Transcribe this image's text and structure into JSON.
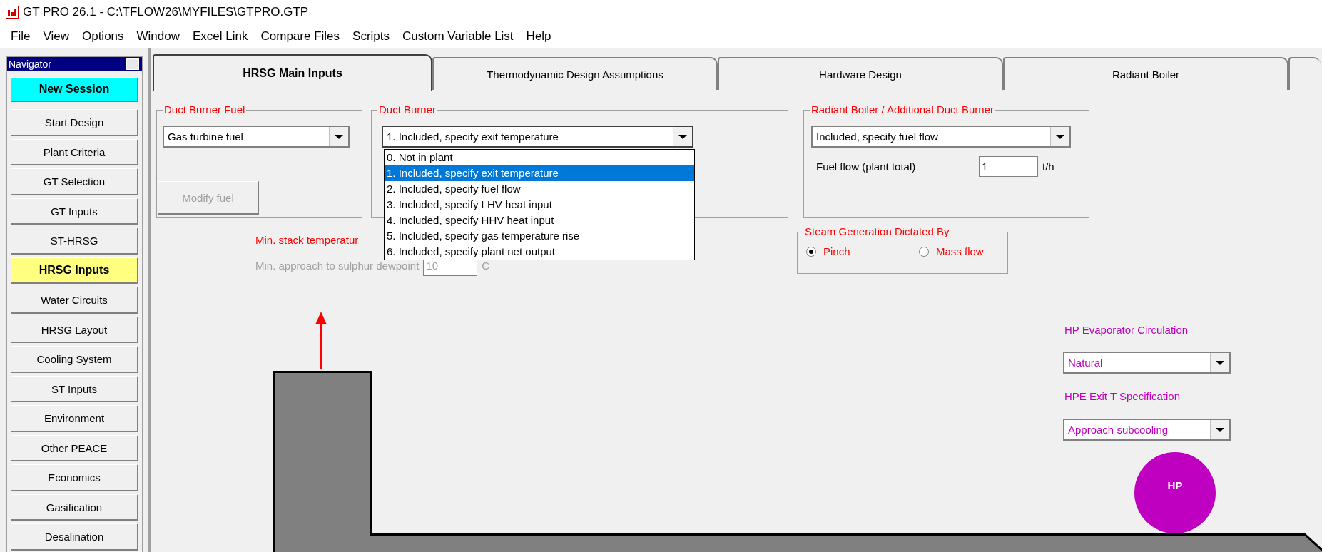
{
  "window": {
    "title": "GT PRO 26.1 - C:\\TFLOW26\\MYFILES\\GTPRO.GTP"
  },
  "menu": [
    "File",
    "View",
    "Options",
    "Window",
    "Excel Link",
    "Compare Files",
    "Scripts",
    "Custom Variable List",
    "Help"
  ],
  "navigator": {
    "title": "Navigator",
    "items": [
      {
        "label": "New Session",
        "kind": "action",
        "selected": false
      },
      {
        "label": "Start Design",
        "kind": "step",
        "selected": false
      },
      {
        "label": "Plant Criteria",
        "kind": "step",
        "selected": false
      },
      {
        "label": "GT Selection",
        "kind": "step",
        "selected": false
      },
      {
        "label": "GT Inputs",
        "kind": "step",
        "selected": false
      },
      {
        "label": "ST-HRSG",
        "kind": "step",
        "selected": false
      },
      {
        "label": "HRSG Inputs",
        "kind": "step",
        "selected": true
      },
      {
        "label": "Water Circuits",
        "kind": "step",
        "selected": false
      },
      {
        "label": "HRSG Layout",
        "kind": "step",
        "selected": false
      },
      {
        "label": "Cooling System",
        "kind": "step",
        "selected": false
      },
      {
        "label": "ST Inputs",
        "kind": "step",
        "selected": false
      },
      {
        "label": "Environment",
        "kind": "step",
        "selected": false
      },
      {
        "label": "Other PEACE",
        "kind": "step",
        "selected": false
      },
      {
        "label": "Economics",
        "kind": "step",
        "selected": false
      },
      {
        "label": "Gasification",
        "kind": "step",
        "selected": false
      },
      {
        "label": "Desalination",
        "kind": "step",
        "selected": false
      }
    ]
  },
  "tabs": [
    {
      "label": "HRSG Main Inputs",
      "selected": true
    },
    {
      "label": "Thermodynamic Design Assumptions",
      "selected": false
    },
    {
      "label": "Hardware Design",
      "selected": false
    },
    {
      "label": "Radiant Boiler",
      "selected": false
    }
  ],
  "duct_burner_fuel": {
    "title": "Duct Burner Fuel",
    "value": "Gas turbine fuel",
    "button": {
      "label": "Modify fuel",
      "disabled": true
    }
  },
  "duct_burner": {
    "title": "Duct Burner",
    "value": "1. Included, specify exit temperature",
    "expanded": true,
    "options": [
      {
        "label": "0. Not in plant",
        "selected": false
      },
      {
        "label": "1. Included, specify exit temperature",
        "selected": true
      },
      {
        "label": "2. Included, specify fuel flow",
        "selected": false
      },
      {
        "label": "3. Included, specify LHV heat input",
        "selected": false
      },
      {
        "label": "4. Included, specify HHV heat input",
        "selected": false
      },
      {
        "label": "5. Included, specify gas temperature rise",
        "selected": false
      },
      {
        "label": "6. Included, specify plant net output",
        "selected": false
      }
    ]
  },
  "radiant_boiler": {
    "title": "Radiant Boiler / Additional Duct Burner",
    "value": "Included, specify fuel flow",
    "fuel_flow": {
      "label": "Fuel flow (plant total)",
      "value": "1",
      "unit": "t/h"
    }
  },
  "stack": {
    "min_stack_label": "Min. stack temperatur",
    "min_approach": {
      "label": "Min. approach to sulphur dewpoint",
      "value": "10",
      "unit": "C",
      "disabled": true
    }
  },
  "steam_generation": {
    "title": "Steam Generation Dictated By",
    "options": [
      {
        "label": "Pinch",
        "selected": true
      },
      {
        "label": "Mass flow",
        "selected": false
      }
    ]
  },
  "hp_evaporator": {
    "label": "HP Evaporator Circulation",
    "value": "Natural"
  },
  "hpe_exit": {
    "label": "HPE Exit T Specification",
    "value": "Approach subcooling"
  },
  "diagram": {
    "drum_label": "HP"
  }
}
